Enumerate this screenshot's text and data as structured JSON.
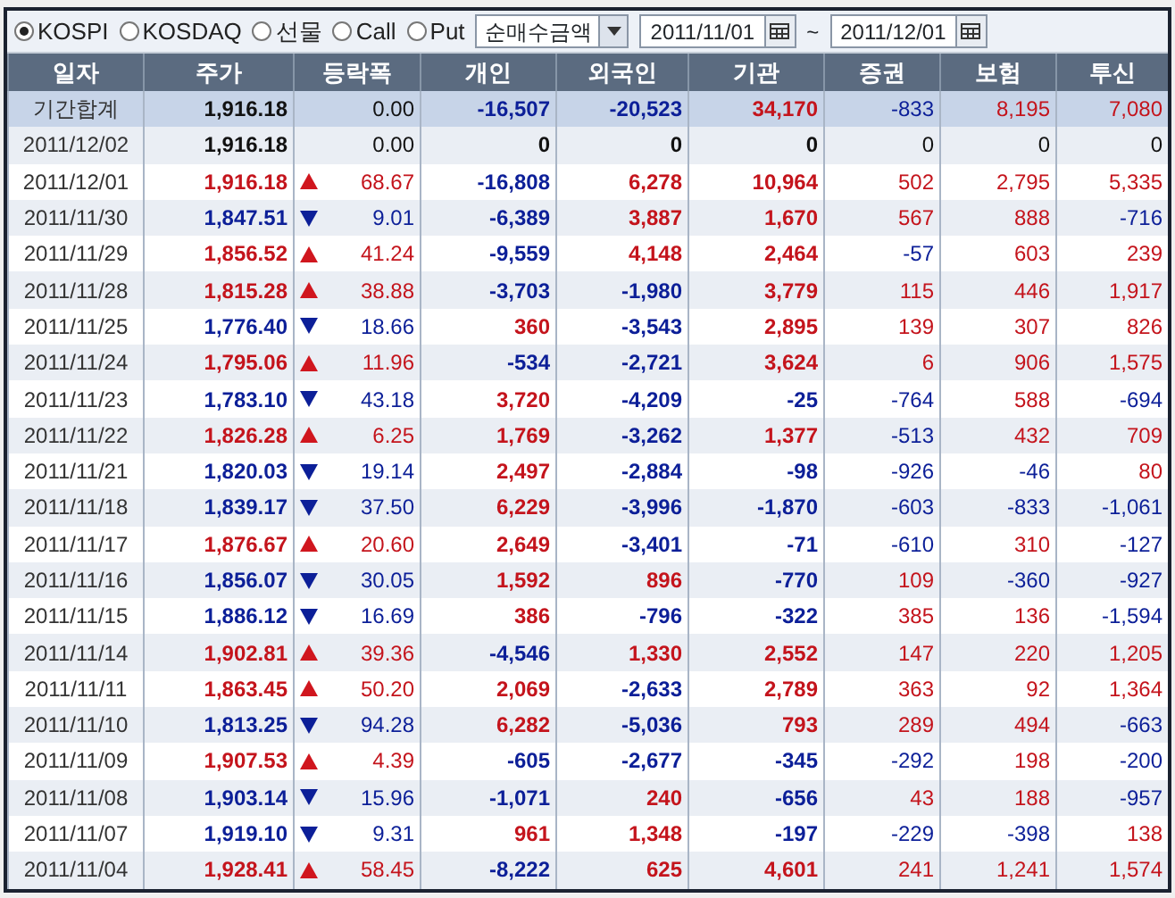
{
  "markets": [
    {
      "label": "KOSPI",
      "selected": true
    },
    {
      "label": "KOSDAQ",
      "selected": false
    },
    {
      "label": "선물",
      "selected": false
    },
    {
      "label": "Call",
      "selected": false
    },
    {
      "label": "Put",
      "selected": false
    }
  ],
  "measure": {
    "value": "순매수금액"
  },
  "date_from": {
    "value": "2011/11/01"
  },
  "range_sep": "~",
  "date_to": {
    "value": "2011/12/01"
  },
  "columns": [
    "일자",
    "주가",
    "등락폭",
    "개인",
    "외국인",
    "기관",
    "증권",
    "보험",
    "투신"
  ],
  "rows": [
    {
      "kind": "total",
      "date": "기간합계",
      "price": "1,916.18",
      "up": false,
      "down": false,
      "change": "0.00",
      "values": [
        "-16,507",
        "-20,523",
        "34,170",
        "-833",
        "8,195",
        "7,080"
      ]
    },
    {
      "kind": "day",
      "date": "2011/12/02",
      "price": "1,916.18",
      "up": false,
      "down": false,
      "change": "0.00",
      "values": [
        "0",
        "0",
        "0",
        "0",
        "0",
        "0"
      ]
    },
    {
      "kind": "day",
      "date": "2011/12/01",
      "price": "1,916.18",
      "up": true,
      "down": false,
      "change": "68.67",
      "values": [
        "-16,808",
        "6,278",
        "10,964",
        "502",
        "2,795",
        "5,335"
      ]
    },
    {
      "kind": "day",
      "date": "2011/11/30",
      "price": "1,847.51",
      "up": false,
      "down": true,
      "change": "9.01",
      "values": [
        "-6,389",
        "3,887",
        "1,670",
        "567",
        "888",
        "-716"
      ]
    },
    {
      "kind": "day",
      "date": "2011/11/29",
      "price": "1,856.52",
      "up": true,
      "down": false,
      "change": "41.24",
      "values": [
        "-9,559",
        "4,148",
        "2,464",
        "-57",
        "603",
        "239"
      ]
    },
    {
      "kind": "day",
      "date": "2011/11/28",
      "price": "1,815.28",
      "up": true,
      "down": false,
      "change": "38.88",
      "values": [
        "-3,703",
        "-1,980",
        "3,779",
        "115",
        "446",
        "1,917"
      ]
    },
    {
      "kind": "day",
      "date": "2011/11/25",
      "price": "1,776.40",
      "up": false,
      "down": true,
      "change": "18.66",
      "values": [
        "360",
        "-3,543",
        "2,895",
        "139",
        "307",
        "826"
      ]
    },
    {
      "kind": "day",
      "date": "2011/11/24",
      "price": "1,795.06",
      "up": true,
      "down": false,
      "change": "11.96",
      "values": [
        "-534",
        "-2,721",
        "3,624",
        "6",
        "906",
        "1,575"
      ]
    },
    {
      "kind": "day",
      "date": "2011/11/23",
      "price": "1,783.10",
      "up": false,
      "down": true,
      "change": "43.18",
      "values": [
        "3,720",
        "-4,209",
        "-25",
        "-764",
        "588",
        "-694"
      ]
    },
    {
      "kind": "day",
      "date": "2011/11/22",
      "price": "1,826.28",
      "up": true,
      "down": false,
      "change": "6.25",
      "values": [
        "1,769",
        "-3,262",
        "1,377",
        "-513",
        "432",
        "709"
      ]
    },
    {
      "kind": "day",
      "date": "2011/11/21",
      "price": "1,820.03",
      "up": false,
      "down": true,
      "change": "19.14",
      "values": [
        "2,497",
        "-2,884",
        "-98",
        "-926",
        "-46",
        "80"
      ]
    },
    {
      "kind": "day",
      "date": "2011/11/18",
      "price": "1,839.17",
      "up": false,
      "down": true,
      "change": "37.50",
      "values": [
        "6,229",
        "-3,996",
        "-1,870",
        "-603",
        "-833",
        "-1,061"
      ]
    },
    {
      "kind": "day",
      "date": "2011/11/17",
      "price": "1,876.67",
      "up": true,
      "down": false,
      "change": "20.60",
      "values": [
        "2,649",
        "-3,401",
        "-71",
        "-610",
        "310",
        "-127"
      ]
    },
    {
      "kind": "day",
      "date": "2011/11/16",
      "price": "1,856.07",
      "up": false,
      "down": true,
      "change": "30.05",
      "values": [
        "1,592",
        "896",
        "-770",
        "109",
        "-360",
        "-927"
      ]
    },
    {
      "kind": "day",
      "date": "2011/11/15",
      "price": "1,886.12",
      "up": false,
      "down": true,
      "change": "16.69",
      "values": [
        "386",
        "-796",
        "-322",
        "385",
        "136",
        "-1,594"
      ]
    },
    {
      "kind": "day",
      "date": "2011/11/14",
      "price": "1,902.81",
      "up": true,
      "down": false,
      "change": "39.36",
      "values": [
        "-4,546",
        "1,330",
        "2,552",
        "147",
        "220",
        "1,205"
      ]
    },
    {
      "kind": "day",
      "date": "2011/11/11",
      "price": "1,863.45",
      "up": true,
      "down": false,
      "change": "50.20",
      "values": [
        "2,069",
        "-2,633",
        "2,789",
        "363",
        "92",
        "1,364"
      ]
    },
    {
      "kind": "day",
      "date": "2011/11/10",
      "price": "1,813.25",
      "up": false,
      "down": true,
      "change": "94.28",
      "values": [
        "6,282",
        "-5,036",
        "793",
        "289",
        "494",
        "-663"
      ]
    },
    {
      "kind": "day",
      "date": "2011/11/09",
      "price": "1,907.53",
      "up": true,
      "down": false,
      "change": "4.39",
      "values": [
        "-605",
        "-2,677",
        "-345",
        "-292",
        "198",
        "-200"
      ]
    },
    {
      "kind": "day",
      "date": "2011/11/08",
      "price": "1,903.14",
      "up": false,
      "down": true,
      "change": "15.96",
      "values": [
        "-1,071",
        "240",
        "-656",
        "43",
        "188",
        "-957"
      ]
    },
    {
      "kind": "day",
      "date": "2011/11/07",
      "price": "1,919.10",
      "up": false,
      "down": true,
      "change": "9.31",
      "values": [
        "961",
        "1,348",
        "-197",
        "-229",
        "-398",
        "138"
      ]
    },
    {
      "kind": "day",
      "date": "2011/11/04",
      "price": "1,928.41",
      "up": true,
      "down": false,
      "change": "58.45",
      "values": [
        "-8,222",
        "625",
        "4,601",
        "241",
        "1,241",
        "1,574"
      ]
    }
  ]
}
